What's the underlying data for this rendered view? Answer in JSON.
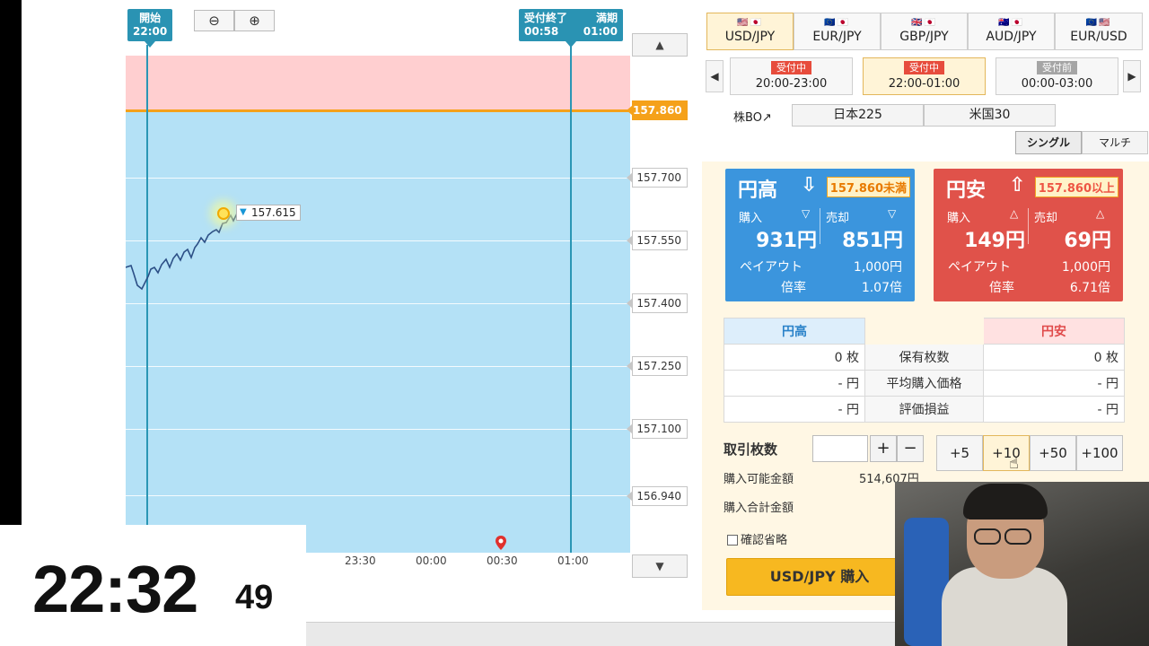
{
  "chart": {
    "start_flag": {
      "label": "開始",
      "time": "22:00"
    },
    "end_flag": {
      "label": "受付終了",
      "time": "00:58",
      "label2": "満期",
      "time2": "01:00"
    },
    "current_price": "157.615",
    "price_labels": [
      "157.860",
      "157.700",
      "157.550",
      "157.400",
      "157.250",
      "157.100",
      "156.940"
    ],
    "x_ticks": [
      "23:30",
      "00:00",
      "00:30",
      "01:00"
    ],
    "scroll_up": "▲",
    "scroll_down": "▼",
    "zoom_out": "⊖",
    "zoom_in": "⊕",
    "colors": {
      "high_zone": "#ffcfd0",
      "low_zone": "#b4e1f6",
      "strike": "#f5a11a",
      "time_line": "#2a96b5"
    }
  },
  "clock": {
    "main": "22:32",
    "seconds": "49"
  },
  "pairs": [
    {
      "label": "USD/JPY",
      "flags": "🇺🇸🇯🇵",
      "active": true
    },
    {
      "label": "EUR/JPY",
      "flags": "🇪🇺🇯🇵",
      "active": false
    },
    {
      "label": "GBP/JPY",
      "flags": "🇬🇧🇯🇵",
      "active": false
    },
    {
      "label": "AUD/JPY",
      "flags": "🇦🇺🇯🇵",
      "active": false
    },
    {
      "label": "EUR/USD",
      "flags": "🇪🇺🇺🇸",
      "active": false
    }
  ],
  "sessions": [
    {
      "status": "受付中",
      "time": "20:00-23:00"
    },
    {
      "status": "受付中",
      "time": "22:00-01:00"
    },
    {
      "status": "受付前",
      "time": "00:00-03:00"
    }
  ],
  "nav": {
    "prev": "◀",
    "next": "▶"
  },
  "stock_bo": {
    "label": "株BO↗",
    "items": [
      "日本225",
      "米国30"
    ]
  },
  "modes": [
    "シングル",
    "マルチ"
  ],
  "card_up": {
    "title": "円高",
    "arrow": "⇩",
    "strike": "157.860未満",
    "buy_label": "購入",
    "sell_label": "売却",
    "tri": "▽",
    "buy_price": "931円",
    "sell_price": "851円",
    "payout_label": "ペイアウト",
    "payout": "1,000円",
    "ratio_label": "倍率",
    "ratio": "1.07倍"
  },
  "card_down": {
    "title": "円安",
    "arrow": "⇧",
    "strike": "157.860以上",
    "buy_label": "購入",
    "sell_label": "売却",
    "tri": "△",
    "buy_price": "149円",
    "sell_price": "69円",
    "payout_label": "ペイアウト",
    "payout": "1,000円",
    "ratio_label": "倍率",
    "ratio": "6.71倍"
  },
  "holdings": {
    "header_up": "円高",
    "header_down": "円安",
    "rows": [
      {
        "up": "0 枚",
        "label": "保有枚数",
        "down": "0 枚"
      },
      {
        "up": "- 円",
        "label": "平均購入価格",
        "down": "- 円"
      },
      {
        "up": "- 円",
        "label": "評価損益",
        "down": "- 円"
      }
    ]
  },
  "trade": {
    "qty_label": "取引枚数",
    "plus": "+",
    "minus": "−",
    "qty_buttons": [
      "+5",
      "+10",
      "+50",
      "+100"
    ],
    "available_label": "購入可能金額",
    "available_value": "514,607円",
    "total_label": "購入合計金額",
    "confirm_label": "確認省略",
    "buy_button": "USD/JPY 購入"
  }
}
